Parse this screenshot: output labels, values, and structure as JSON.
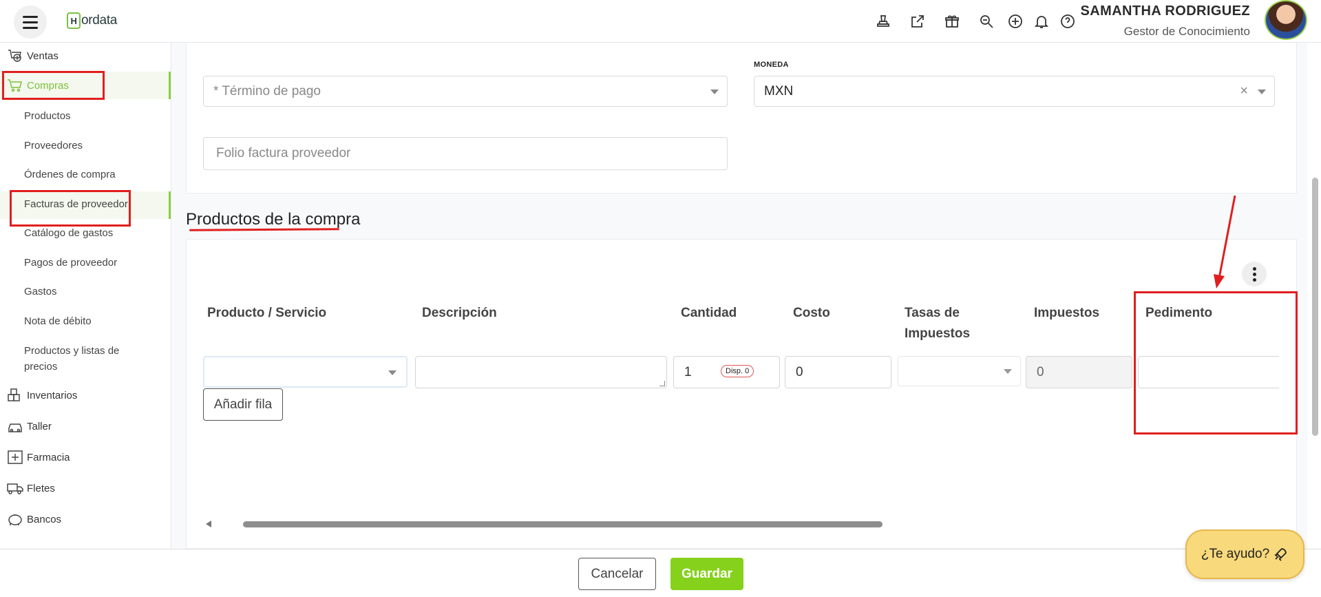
{
  "app": {
    "logo_text": "ordata",
    "logo_letter": "H"
  },
  "header": {
    "user_name": "SAMANTHA RODRIGUEZ",
    "user_role": "Gestor de Conocimiento",
    "icons": [
      "stamp-icon",
      "external-link-icon",
      "gift-icon",
      "search-zoom-icon",
      "plus-circle-icon",
      "bell-icon",
      "help-circle-icon"
    ]
  },
  "sidebar": {
    "items": [
      {
        "label": "Ventas",
        "icon": "sales-icon"
      },
      {
        "label": "Compras",
        "icon": "cart-icon"
      },
      {
        "label": "Inventarios",
        "icon": "inventory-icon"
      },
      {
        "label": "Taller",
        "icon": "car-icon"
      },
      {
        "label": "Farmacia",
        "icon": "pharmacy-icon"
      },
      {
        "label": "Fletes",
        "icon": "truck-icon"
      },
      {
        "label": "Bancos",
        "icon": "piggy-bank-icon"
      }
    ],
    "subitems": [
      {
        "label": "Productos"
      },
      {
        "label": "Proveedores"
      },
      {
        "label": "Órdenes de compra"
      },
      {
        "label": "Facturas de proveedor"
      },
      {
        "label": "Catálogo de gastos"
      },
      {
        "label": "Pagos de proveedor"
      },
      {
        "label": "Gastos"
      },
      {
        "label": "Nota de débito"
      },
      {
        "label": "Productos y listas de precios"
      }
    ]
  },
  "form": {
    "payment_term_placeholder": "* Término de pago",
    "currency_label": "MONEDA",
    "currency_value": "MXN",
    "clear_symbol": "×",
    "supplier_invoice_placeholder": "Folio factura proveedor"
  },
  "products": {
    "section_title": "Productos de la compra",
    "columns": [
      "Producto / Servicio",
      "Descripción",
      "Cantidad",
      "Costo",
      "Tasas de Impuestos",
      "Impuestos",
      "Pedimento"
    ],
    "row": {
      "quantity": "1",
      "available_badge": "Disp. 0",
      "cost": "0",
      "taxes": "0"
    },
    "add_row_label": "Añadir fila"
  },
  "footer": {
    "cancel_label": "Cancelar",
    "save_label": "Guardar"
  },
  "help_button": {
    "label": "¿Te ayudo?"
  },
  "colors": {
    "accent": "#8dcf3f",
    "annotation_red": "#e01e1e",
    "help_yellow": "#f8d97c"
  }
}
